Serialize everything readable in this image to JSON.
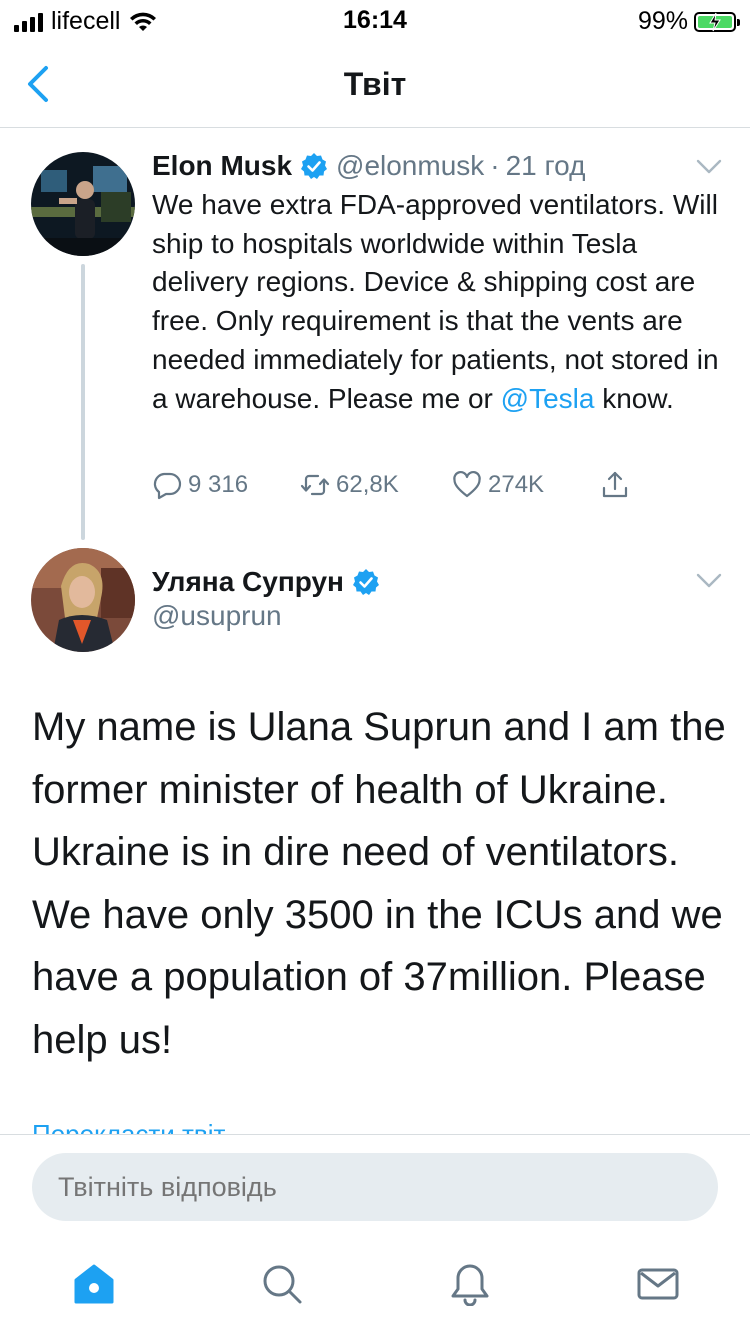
{
  "status_bar": {
    "carrier": "lifecell",
    "time": "16:14",
    "battery": "99%",
    "battery_level": 0.99
  },
  "nav": {
    "title": "Твіт",
    "back_icon": "chevron-left-icon"
  },
  "tweet_parent": {
    "name": "Elon Musk",
    "handle": "@elonmusk",
    "separator": "·",
    "time": "21 год",
    "text_before": "We have extra FDA-approved ventilators. Will ship to hospitals worldwide within Tesla delivery regions. Device & shipping cost are free. Only requirement is that the vents are needed immediately for patients, not stored in a warehouse. Please me or ",
    "mention": "@Tesla",
    "text_after": " know.",
    "replies": "9 316",
    "retweets": "62,8K",
    "likes": "274K"
  },
  "tweet_main": {
    "name": "Уляна Супрун",
    "handle": "@usuprun",
    "text": "My name is Ulana Suprun and I am the former minister of health of Ukraine. Ukraine is in dire need of ventilators. We have only 3500 in the ICUs and we have a population of 37million. Please help us!",
    "translate_link": "Перекласти твіт"
  },
  "reply": {
    "placeholder": "Твітніть відповідь"
  },
  "tabbar": {
    "items": [
      "home-icon",
      "search-icon",
      "notifications-icon",
      "messages-icon"
    ],
    "active": "home-icon"
  },
  "colors": {
    "accent": "#1da1f2",
    "secondary_text": "#657786",
    "divider": "#d8dde0",
    "verified": "#1da1f2"
  }
}
